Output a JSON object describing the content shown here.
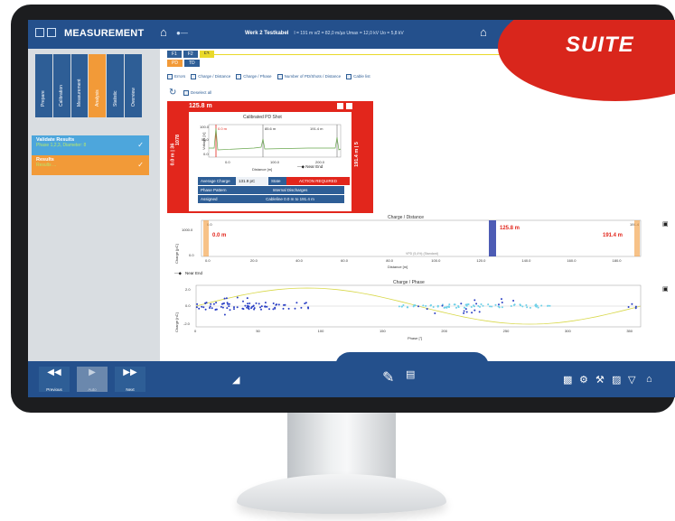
{
  "app": {
    "title": "MEASUREMENT",
    "cable_name": "Werk 2 Testkabel",
    "cable_info": "l = 191 m   v/2 = 82,0 m/µs   Umax = 12,0 kV   Uo = 5,8 kV"
  },
  "badge": {
    "text": "SUITE"
  },
  "sidebar": {
    "tabs": [
      "Prepare",
      "Calibration",
      "Measurement",
      "Analysis",
      "Statistic",
      "Overview"
    ],
    "active_tab": "Analysis",
    "steps": [
      {
        "title": "Validate Results",
        "subtitle": "Phase 1,2,3, Diameter: 8"
      },
      {
        "title": "Results",
        "subtitle": "Results ..."
      }
    ],
    "nav": {
      "previous": "Previous",
      "auto": "Auto",
      "next": "Next"
    }
  },
  "phase_tabs": [
    "F1",
    "F2",
    "F3"
  ],
  "mode_tabs": [
    "PD",
    "TD"
  ],
  "options": [
    "Errors",
    "Charge / Distance",
    "Charge / Phase",
    "Number of PD/Shots / Distance",
    "Cable list"
  ],
  "deselect_label": "Deselect all",
  "detail": {
    "location": "125.8 m",
    "left_range": "0.0 m | 36",
    "left_count": "1078",
    "right_range": "191.4 m | 5",
    "chart_title": "Calibrated PD Shot",
    "ylabel": "Voltage [V]",
    "xlabel": "Distance [m]",
    "yticks": [
      "100.0",
      "50.0",
      "0.0"
    ],
    "xticks": [
      "0.0",
      "100.0",
      "200.0"
    ],
    "markers": [
      "0.0 m",
      "85.6 m",
      "191.4 m"
    ],
    "near_end": "Near End",
    "table": {
      "avg_charge_label": "Average Charge",
      "avg_charge_value": "131.9 pC",
      "state_label": "State",
      "state_value": "ACTION REQUIRED",
      "pattern_label": "Phase Pattern",
      "pattern_value": "Internal Discharges",
      "element_label": "Assigned Cableelement",
      "element_value": "Cableline 0.0 m to 191.4 m"
    }
  },
  "charge_distance": {
    "title": "Charge / Distance",
    "ylabel": "Charge [pC]",
    "xlabel": "Distance [m]",
    "ytick_top": "1000.0",
    "ytick_bottom": "0.0",
    "xticks": [
      "0.0",
      "20.0",
      "40.0",
      "60.0",
      "80.0",
      "100.0",
      "120.0",
      "140.0",
      "160.0",
      "180.0"
    ],
    "markers": [
      "0.0 m",
      "125.8 m",
      "191.4 m"
    ],
    "top_labels": [
      "0.0",
      "191.4"
    ],
    "near_end": "Near End",
    "standard": "VPD (5,4%) (Standard)"
  },
  "charge_phase": {
    "title": "Charge / Phase",
    "ylabel": "Charge [nC]",
    "xlabel": "Phase [°]",
    "yticks": [
      "2.0",
      "0.0",
      "-2.0"
    ],
    "xticks": [
      "0",
      "50",
      "100",
      "150",
      "200",
      "250",
      "300",
      "350"
    ]
  },
  "footer_tab": "F2"
}
